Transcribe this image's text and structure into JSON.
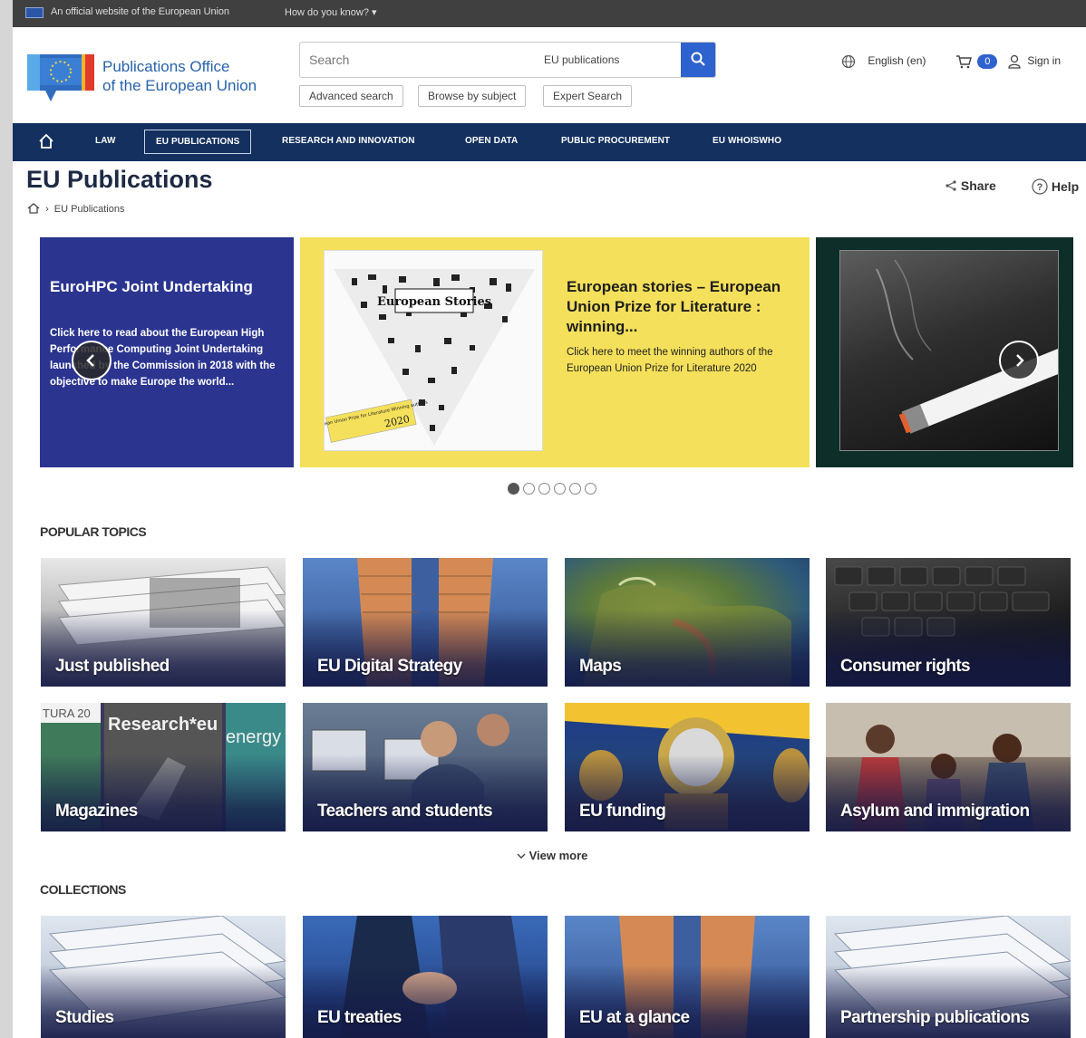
{
  "official_bar": {
    "text": "An official website of the European Union",
    "how": "How do you know?"
  },
  "header": {
    "logo_line1": "Publications Office",
    "logo_line2": "of the European Union",
    "search_placeholder": "Search",
    "search_scope": "EU publications",
    "advanced_search": "Advanced search",
    "browse_by_subject": "Browse by subject",
    "expert_search": "Expert Search",
    "language": "English (en)",
    "cart_count": "0",
    "sign_in": "Sign in"
  },
  "nav": {
    "items": [
      "LAW",
      "EU PUBLICATIONS",
      "RESEARCH AND INNOVATION",
      "OPEN DATA",
      "PUBLIC PROCUREMENT",
      "EU WHOISWHO"
    ]
  },
  "page": {
    "title": "EU Publications",
    "share": "Share",
    "help": "Help",
    "breadcrumb": "EU Publications"
  },
  "carousel": {
    "slides": [
      {
        "title": "EuroHPC Joint Undertaking",
        "text": "Click here to read about the European High Performance Computing Joint Undertaking launched by the Commission in 2018 with the objective to make Europe the world..."
      },
      {
        "title": "European stories – European Union Prize for Literature : winning...",
        "text": "Click here to meet the winning authors of the European Union Prize for Literature 2020",
        "cover_title": "European Stories",
        "cover_note": "European Union Prize for Literature Winning authors",
        "cover_year": "2020"
      },
      {
        "title": "",
        "text": ""
      }
    ],
    "dot_count": 6,
    "active_dot": 0
  },
  "popular_topics": {
    "title": "POPULAR TOPICS",
    "items": [
      "Just published",
      "EU Digital Strategy",
      "Maps",
      "Consumer rights",
      "Magazines",
      "Teachers and students",
      "EU funding",
      "Asylum and immigration"
    ],
    "magazine_covers": [
      "TURA 20",
      "Research*eu",
      "energy"
    ],
    "view_more": "View more"
  },
  "collections": {
    "title": "COLLECTIONS",
    "items": [
      "Studies",
      "EU treaties",
      "EU at a glance",
      "Partnership publications"
    ]
  },
  "colors": {
    "nav_bg": "#13305f",
    "brand_blue": "#2762ad",
    "button_blue": "#2e62ce",
    "slide1_bg": "#2b3590",
    "slide2_bg": "#f4e05a",
    "slide3_bg": "#0e2e2a"
  }
}
